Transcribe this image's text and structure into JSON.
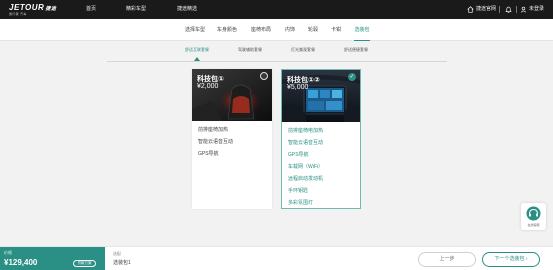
{
  "brand": {
    "logo_main": "JETOUR",
    "logo_suffix": "捷途",
    "logo_sub": "旅行者 汽车"
  },
  "topnav": {
    "items": [
      "首页",
      "精彩车型",
      "捷途精选"
    ],
    "app_download": "捷途官网",
    "login": "未登录"
  },
  "steps": [
    "选择车型",
    "车身颜色",
    "座椅布局",
    "内饰",
    "轮毂",
    "卡钳",
    "选装包"
  ],
  "active_step": 6,
  "subtabs": [
    "舒适互联套餐",
    "驾驶辅助套餐",
    "灯光美观套餐",
    "舒适便捷套餐"
  ],
  "packages": [
    {
      "title": "科技包①",
      "price": "¥2,000",
      "selected": false,
      "features": [
        "前排座椅加热",
        "智能云语音互动",
        "GPS导航"
      ]
    },
    {
      "title": "科技包①②",
      "price": "¥5,000",
      "selected": true,
      "features": [
        "前排座椅电加热",
        "智能云语音互动",
        "GPS导航",
        "车载网（WiFi）",
        "远程启动发动机",
        "手环钥匙",
        "多彩氛围灯"
      ]
    }
  ],
  "help": {
    "label": "在线客服"
  },
  "bottom": {
    "price_label": "价格",
    "price_value": "¥129,400",
    "finance_button": "贷款方案",
    "selected_label": "选配",
    "selected_value": "选装包1",
    "prev_button": "上一步",
    "next_button": "下一个选装包"
  },
  "colors": {
    "accent": "#2a8f85",
    "nav_bg": "#1a1a1a"
  }
}
